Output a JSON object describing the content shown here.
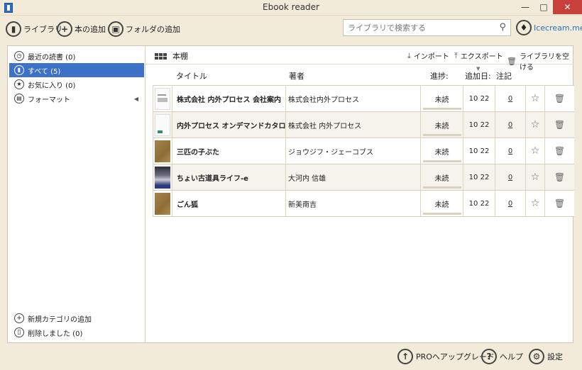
{
  "window": {
    "title": "Ebook reader",
    "minimize": "—",
    "maximize": "□",
    "close": "✕"
  },
  "toolbar": {
    "library_label": "ライブラリ",
    "add_book_label": "本の追加",
    "add_folder_label": "フォルダの追加",
    "search_placeholder": "ライブラリで検索する",
    "brand": "Icecream.me"
  },
  "sidebar": {
    "items": [
      {
        "label": "最近の読書 (0)",
        "icon": "clock-icon"
      },
      {
        "label": "すべて (5)",
        "icon": "book-icon",
        "selected": true
      },
      {
        "label": "お気に入り (0)",
        "icon": "star-icon"
      },
      {
        "label": "フォーマット",
        "icon": "format-icon"
      }
    ],
    "add_category": "新規カテゴリの追加",
    "deleted": "削除しました (0)"
  },
  "content": {
    "shelf_title": "本棚",
    "import_label": "インポート",
    "export_label": "エクスポート",
    "clear_label": "ライブラリを空ける",
    "columns": {
      "title": "タイトル",
      "author": "著者",
      "progress": "進捗:",
      "added": "追加日:",
      "notes": "注記"
    },
    "books": [
      {
        "title": "株式会社 内外プロセス 会社案内",
        "author": "株式会社内外プロセス",
        "progress": "未読",
        "added": "10 22",
        "notes": "0",
        "cover": "doc"
      },
      {
        "title": "内外プロセス オンデマンドカタログ",
        "author": "株式会社 内外プロセス",
        "progress": "未読",
        "added": "10 22",
        "notes": "0",
        "cover": "doc2"
      },
      {
        "title": "三匹の子ぶた",
        "author": "ジョウジフ・ジェーコブス",
        "progress": "未読",
        "added": "10 22",
        "notes": "0",
        "cover": "brown"
      },
      {
        "title": "ちょい古道具ライフ-e",
        "author": "大河内 信雄",
        "progress": "未読",
        "added": "10 22",
        "notes": "0",
        "cover": "photo"
      },
      {
        "title": "ごん狐",
        "author": "新美南吉",
        "progress": "未読",
        "added": "10 22",
        "notes": "0",
        "cover": "brown"
      }
    ]
  },
  "footer": {
    "upgrade_label": "PROへアップグレード",
    "help_label": "ヘルプ",
    "settings_label": "設定"
  },
  "colors": {
    "background": "#f2ebd9",
    "selected": "#3d72c8",
    "close": "#c7403a",
    "brand": "#2a70b8"
  }
}
